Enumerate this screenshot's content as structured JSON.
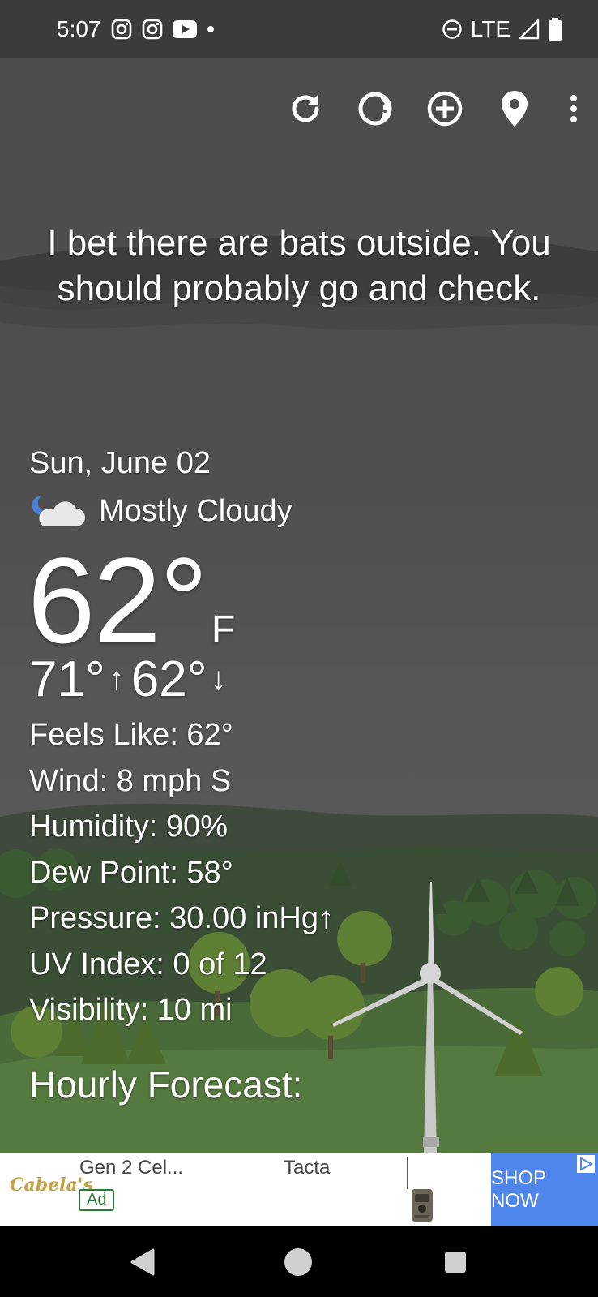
{
  "status_bar": {
    "time": "5:07",
    "left_icons": [
      "instagram-icon",
      "instagram-icon",
      "youtube-icon",
      "dot-icon"
    ],
    "network": "LTE",
    "right_icons": [
      "do-not-disturb-icon",
      "signal-icon",
      "battery-icon"
    ]
  },
  "toolbar": {
    "icons": [
      "refresh-icon",
      "theme-icon",
      "add-location-icon",
      "location-pin-icon",
      "more-vert-icon"
    ]
  },
  "quote": "I bet there are bats outside. You should probably go and check.",
  "weather": {
    "date": "Sun, June 02",
    "condition": "Mostly Cloudy",
    "condition_icon": "night-partly-cloudy-icon",
    "temperature": "62°",
    "unit": "F",
    "high": "71°",
    "high_arrow": "↑",
    "low": "62°",
    "low_arrow": "↓"
  },
  "details": {
    "feels_like": "Feels Like:  62°",
    "wind": "Wind:  8 mph S",
    "humidity": "Humidity:  90%",
    "dew_point": "Dew Point:  58°",
    "pressure": "Pressure:  30.00 inHg↑",
    "uv_index": "UV Index:  0 of 12",
    "visibility": "Visibility:  10 mi"
  },
  "hourly_title": "Hourly Forecast:",
  "ad": {
    "brand": "Cabela's",
    "title1": "Gen 2 Cel...",
    "badge": "Ad",
    "title2": "Tacta",
    "cta": "SHOP NOW",
    "colors": {
      "cta_bg": "#4f86ec",
      "badge": "#2c7a3a",
      "brand": "#c8a043"
    }
  },
  "navbar": {
    "icons": [
      "back-icon",
      "home-icon",
      "recents-icon"
    ]
  }
}
